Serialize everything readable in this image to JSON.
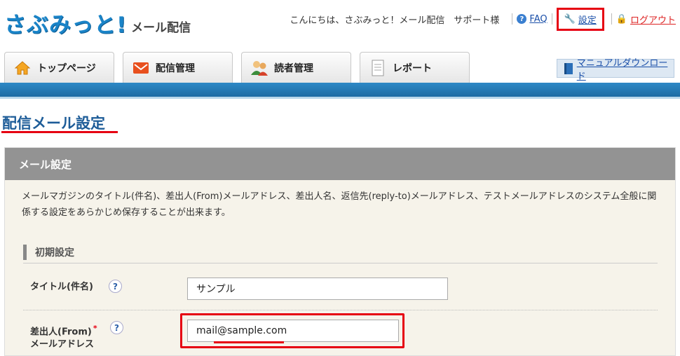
{
  "header": {
    "logo_main": "さぶみっと!",
    "logo_sub": "メール配信",
    "greeting": "こんにちは、さぶみっと！メール配信　サポート様",
    "faq": "FAQ",
    "settings": "設定",
    "logout": "ログアウト"
  },
  "tabs": [
    {
      "label": "トップページ",
      "icon": "home-icon"
    },
    {
      "label": "配信管理",
      "icon": "mail-icon"
    },
    {
      "label": "読者管理",
      "icon": "users-icon"
    },
    {
      "label": "レポート",
      "icon": "report-icon"
    }
  ],
  "manual": "マニュアルダウンロード",
  "page_title": "配信メール設定",
  "panel": {
    "title": "メール設定",
    "description": "メールマガジンのタイトル(件名)、差出人(From)メールアドレス、差出人名、返信先(reply-to)メールアドレス、テストメールアドレスのシステム全般に関係する設定をあらかじめ保存することが出来ます。",
    "section": "初期設定",
    "fields": [
      {
        "label": "タイトル(件名)",
        "value": "サンプル",
        "required": false
      },
      {
        "label_line1": "差出人(From)",
        "label_line2": "メールアドレス",
        "value": "mail@sample.com",
        "required": true,
        "required_mark": "*"
      }
    ],
    "help_glyph": "?"
  },
  "colors": {
    "accent": "#1a84c8",
    "highlight": "#e60012",
    "panel_head": "#939393"
  }
}
